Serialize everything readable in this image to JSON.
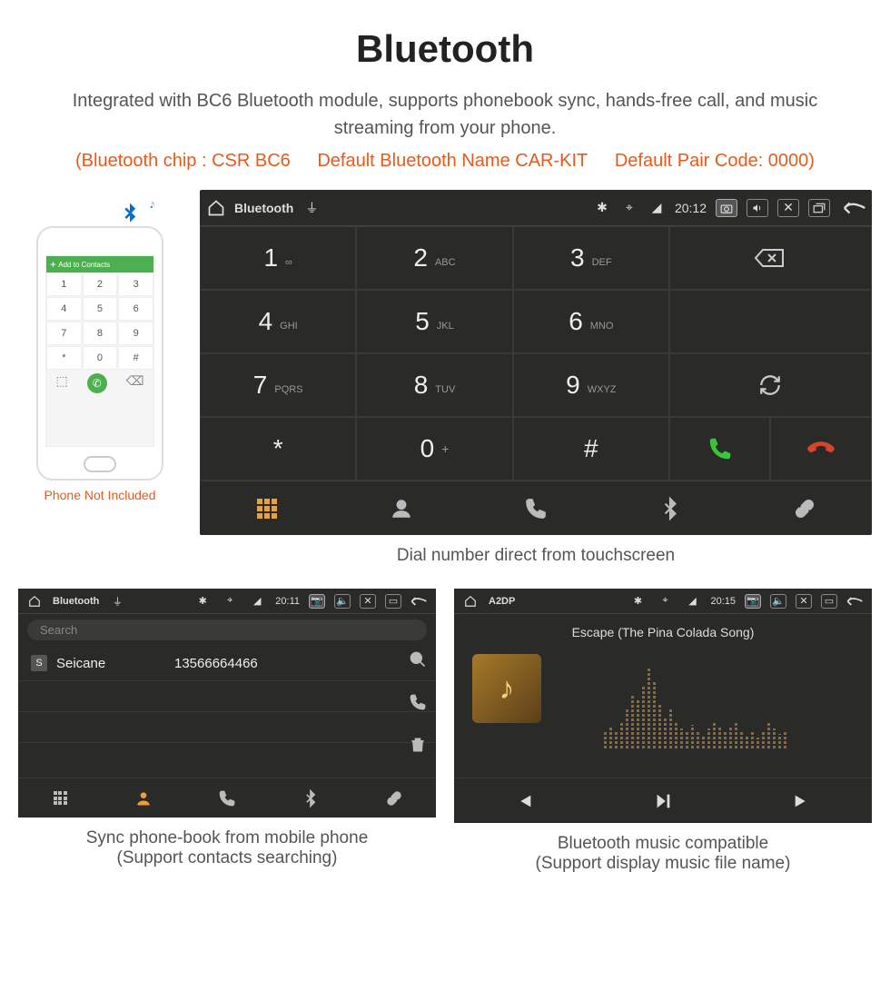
{
  "hero": {
    "title": "Bluetooth",
    "desc": "Integrated with BC6 Bluetooth module, supports phonebook sync, hands-free call, and music streaming from your phone.",
    "spec_chip": "(Bluetooth chip : CSR BC6",
    "spec_name": "Default Bluetooth Name CAR-KIT",
    "spec_code": "Default Pair Code: 0000)"
  },
  "phone": {
    "topbar": "Add to Contacts",
    "note": "Phone Not Included"
  },
  "dialer": {
    "status_title": "Bluetooth",
    "time": "20:12",
    "keys": [
      {
        "num": "1",
        "letters": "∞"
      },
      {
        "num": "2",
        "letters": "ABC"
      },
      {
        "num": "3",
        "letters": "DEF"
      },
      {
        "num": "4",
        "letters": "GHI"
      },
      {
        "num": "5",
        "letters": "JKL"
      },
      {
        "num": "6",
        "letters": "MNO"
      },
      {
        "num": "7",
        "letters": "PQRS"
      },
      {
        "num": "8",
        "letters": "TUV"
      },
      {
        "num": "9",
        "letters": "WXYZ"
      },
      {
        "num": "*",
        "letters": ""
      },
      {
        "num": "0",
        "letters": "+",
        "sup": true
      },
      {
        "num": "#",
        "letters": ""
      }
    ],
    "caption": "Dial number direct from touchscreen"
  },
  "phonebook": {
    "status_title": "Bluetooth",
    "time": "20:11",
    "search_placeholder": "Search",
    "contact_badge": "S",
    "contact_name": "Seicane",
    "contact_number": "13566664466",
    "caption_line1": "Sync phone-book from mobile phone",
    "caption_line2": "(Support contacts searching)"
  },
  "music": {
    "status_title": "A2DP",
    "time": "20:15",
    "track_title": "Escape (The Pina Colada Song)",
    "caption_line1": "Bluetooth music compatible",
    "caption_line2": "(Support display music file name)"
  }
}
